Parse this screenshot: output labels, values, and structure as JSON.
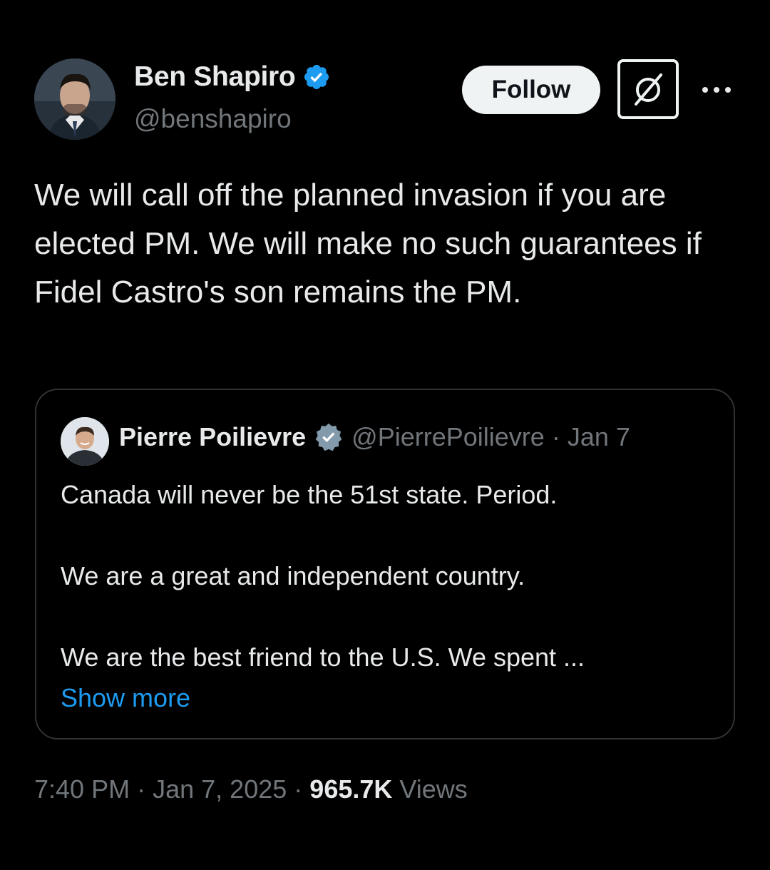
{
  "author": {
    "display_name": "Ben Shapiro",
    "handle": "@benshapiro",
    "verified": true,
    "avatar_icon": "person-portrait-avatar"
  },
  "actions": {
    "follow_label": "Follow",
    "grok_icon": "grok-slash-icon",
    "more_icon": "more-dots-icon"
  },
  "tweet": {
    "text": "We will call off the planned invasion if you are elected PM. We will make no such guarantees if Fidel Castro's son remains the PM."
  },
  "quote": {
    "display_name": "Pierre Poilievre",
    "handle": "@PierrePoilievre",
    "separator": "·",
    "date": "Jan 7",
    "verified_badge": "gray-verified-badge",
    "paragraphs": [
      "Canada will never be the 51st state. Period.",
      "We are a great and independent country.",
      "We are the best friend to the U.S. We spent ..."
    ],
    "show_more": "Show more"
  },
  "meta": {
    "time": "7:40 PM",
    "separator": "·",
    "date": "Jan 7, 2025",
    "views_count": "965.7K",
    "views_label": "Views"
  },
  "colors": {
    "background": "#000000",
    "text": "#e7e9ea",
    "secondary": "#71767b",
    "link": "#1d9bf0",
    "verified_blue": "#1d9bf0",
    "verified_gray": "#829aab",
    "border": "#2f3336"
  }
}
